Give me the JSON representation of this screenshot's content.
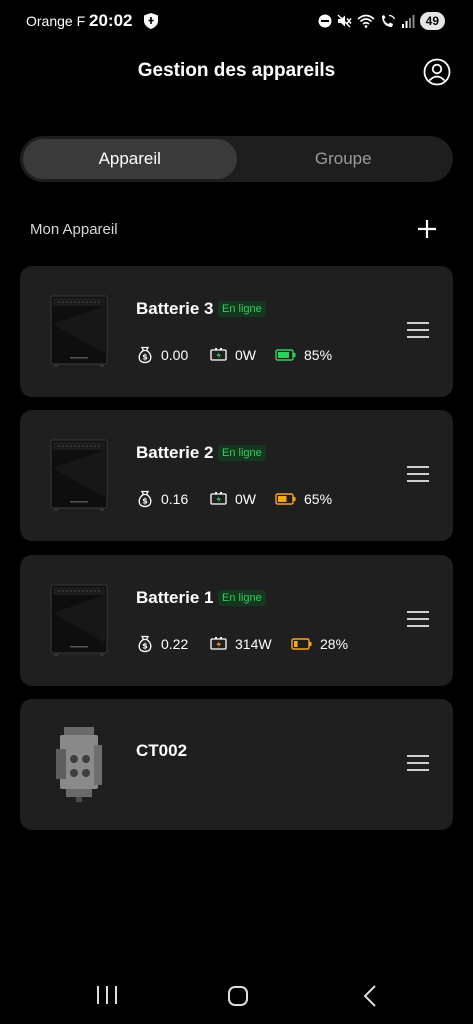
{
  "status_bar": {
    "carrier": "Orange F",
    "time": "20:02",
    "battery_level": "49",
    "icons": [
      "shield-icon",
      "dnd-icon",
      "mute-icon",
      "wifi-icon",
      "wifi-call-icon",
      "signal-icon"
    ]
  },
  "header": {
    "title": "Gestion des appareils",
    "account_icon": "account-circle-icon"
  },
  "tabs": [
    {
      "label": "Appareil",
      "active": true
    },
    {
      "label": "Groupe",
      "active": false
    }
  ],
  "section": {
    "title": "Mon Appareil",
    "add_icon": "plus-icon"
  },
  "devices": [
    {
      "name": "Batterie 3",
      "status": "En ligne",
      "earnings": "0.00",
      "power": "0W",
      "battery": "85%",
      "battery_level": 0.85,
      "battery_color": "#2fd05a",
      "charge_color": "#2fd05a",
      "image": "battery-unit-image"
    },
    {
      "name": "Batterie 2",
      "status": "En ligne",
      "earnings": "0.16",
      "power": "0W",
      "battery": "65%",
      "battery_level": 0.65,
      "battery_color": "#f5a623",
      "charge_color": "#2fd05a",
      "image": "battery-unit-image"
    },
    {
      "name": "Batterie 1",
      "status": "En ligne",
      "earnings": "0.22",
      "power": "314W",
      "battery": "28%",
      "battery_level": 0.28,
      "battery_color": "#f5a623",
      "charge_color": "#f5a623",
      "image": "battery-unit-image"
    },
    {
      "name": "CT002",
      "image": "ct-meter-image"
    }
  ],
  "colors": {
    "background": "#000000",
    "card": "#1f1f1f",
    "online": "#2fd05a",
    "warning": "#f5a623"
  },
  "nav": [
    "recent-apps-icon",
    "home-icon",
    "back-icon"
  ]
}
